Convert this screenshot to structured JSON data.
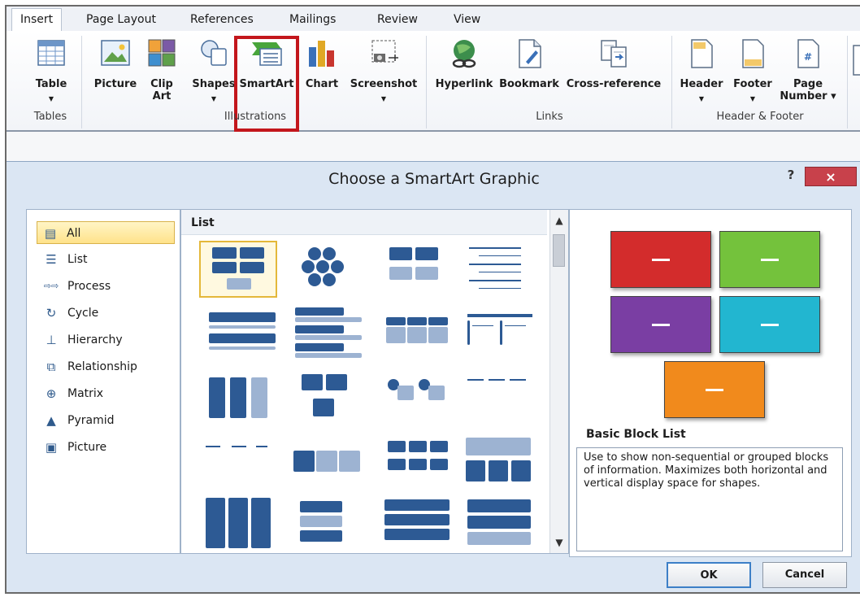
{
  "ribbon": {
    "tabs": [
      "Insert",
      "Page Layout",
      "References",
      "Mailings",
      "Review",
      "View"
    ],
    "active_tab": "Insert",
    "buttons": {
      "table": "Table",
      "picture": "Picture",
      "clip_art_line1": "Clip",
      "clip_art_line2": "Art",
      "shapes": "Shapes",
      "smartart": "SmartArt",
      "chart": "Chart",
      "screenshot": "Screenshot",
      "hyperlink": "Hyperlink",
      "bookmark": "Bookmark",
      "cross_reference": "Cross-reference",
      "header": "Header",
      "footer": "Footer",
      "page_number_line1": "Page",
      "page_number_line2": "Number"
    },
    "groups": {
      "tables": "Tables",
      "illustrations": "Illustrations",
      "links": "Links",
      "header_footer": "Header & Footer"
    },
    "highlight_color": "#c3161c"
  },
  "dialog": {
    "title": "Choose a SmartArt Graphic",
    "help_label": "?",
    "close_label": "×",
    "categories": [
      {
        "label": "All",
        "icon": "all-icon"
      },
      {
        "label": "List",
        "icon": "list-icon"
      },
      {
        "label": "Process",
        "icon": "process-icon"
      },
      {
        "label": "Cycle",
        "icon": "cycle-icon"
      },
      {
        "label": "Hierarchy",
        "icon": "hierarchy-icon"
      },
      {
        "label": "Relationship",
        "icon": "relationship-icon"
      },
      {
        "label": "Matrix",
        "icon": "matrix-icon"
      },
      {
        "label": "Pyramid",
        "icon": "pyramid-icon"
      },
      {
        "label": "Picture",
        "icon": "picture-icon"
      }
    ],
    "selected_category": "All",
    "list_heading": "List",
    "preview": {
      "name": "Basic Block List",
      "description": "Use to show non-sequential or grouped blocks of information. Maximizes both horizontal and vertical display space for shapes.",
      "block_colors": [
        "#d32c2c",
        "#74c23c",
        "#7a3ea3",
        "#22b6d0",
        "#f18a1c"
      ]
    },
    "ok_label": "OK",
    "cancel_label": "Cancel"
  }
}
